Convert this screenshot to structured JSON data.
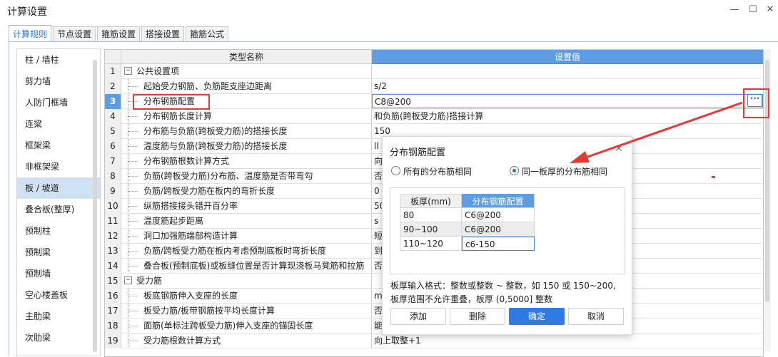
{
  "window": {
    "title": "计算设置",
    "minimize": "—",
    "maximize": "☐",
    "close": "✕"
  },
  "tabs": [
    "计算规则",
    "节点设置",
    "箍筋设置",
    "搭接设置",
    "箍筋公式"
  ],
  "sidebar": {
    "items": [
      "柱 / 墙柱",
      "剪力墙",
      "人防门框墙",
      "连梁",
      "框架梁",
      "非框架梁",
      "板 / 坡道",
      "叠合板(整厚)",
      "预制柱",
      "预制梁",
      "预制墙",
      "空心楼盖板",
      "主肋梁",
      "次肋梁"
    ],
    "selected_index": 6
  },
  "grid": {
    "headers": {
      "name": "类型名称",
      "value": "设置值"
    },
    "rows": [
      {
        "num": "1",
        "name": "公共设置项",
        "value": "",
        "group": true
      },
      {
        "num": "2",
        "name": "起始受力钢筋、负筋距支座边距离",
        "value": "s/2"
      },
      {
        "num": "3",
        "name": "分布钢筋配置",
        "value": "C8@200",
        "selected": true
      },
      {
        "num": "4",
        "name": "分布钢筋长度计算",
        "value": "和负筋(跨板受力筋)搭接计算"
      },
      {
        "num": "5",
        "name": "分布筋与负筋(跨板受力筋)的搭接长度",
        "value": "150"
      },
      {
        "num": "6",
        "name": "温度筋与负筋(跨板受力筋)的搭接长度",
        "value": "ll"
      },
      {
        "num": "7",
        "name": "分布钢筋根数计算方式",
        "value": "向"
      },
      {
        "num": "8",
        "name": "负筋(跨板受力筋)分布筋、温度筋是否带弯勾",
        "value": "否"
      },
      {
        "num": "9",
        "name": "负筋/跨板受力筋在板内的弯折长度",
        "value": "0"
      },
      {
        "num": "10",
        "name": "纵筋搭接接头错开百分率",
        "value": "50"
      },
      {
        "num": "11",
        "name": "温度筋起步距离",
        "value": "s"
      },
      {
        "num": "12",
        "name": "洞口加强筋端部构造计算",
        "value": "短"
      },
      {
        "num": "13",
        "name": "负筋/跨板受力筋在板内考虑预制底板时弯折长度",
        "value": "到"
      },
      {
        "num": "14",
        "name": "叠合板(预制底板)或板缝位置是否计算现浇板马凳筋和拉筋",
        "value": "否"
      },
      {
        "num": "15",
        "name": "受力筋",
        "value": "",
        "group": true
      },
      {
        "num": "16",
        "name": "板底钢筋伸入支座的长度",
        "value": "m"
      },
      {
        "num": "17",
        "name": "板受力筋/板带钢筋按平均长度计算",
        "value": "否"
      },
      {
        "num": "18",
        "name": "面筋(单标注跨板受力筋)伸入支座的锚固长度",
        "value": "能"
      },
      {
        "num": "19",
        "name": "受力筋根数计算方式",
        "value": "向上取整+1"
      }
    ],
    "dots_button": "···"
  },
  "dialog": {
    "title": "分布钢筋配置",
    "close": "✕",
    "radio_all": "所有的分布筋相同",
    "radio_same_thickness": "同一板厚的分布筋相同",
    "selected_radio": "same_thickness",
    "table": {
      "headers": [
        "板厚(mm)",
        "分布钢筋配置"
      ],
      "rows": [
        [
          "80",
          "C6@200"
        ],
        [
          "90~100",
          "C6@200"
        ],
        [
          "110~120",
          "c6-150"
        ]
      ]
    },
    "hint_line1": "板厚输入格式：整数或整数 ~ 整数，如 150 或 150~200,",
    "hint_line2": "板厚范围不允许重叠，板厚 (0,5000] 整数",
    "buttons": {
      "add": "添加",
      "delete": "删除",
      "ok": "确定",
      "cancel": "取消"
    }
  },
  "colors": {
    "accent": "#2f7ae5",
    "highlight": "#e53935",
    "selected_row": "#5d9ee0"
  }
}
